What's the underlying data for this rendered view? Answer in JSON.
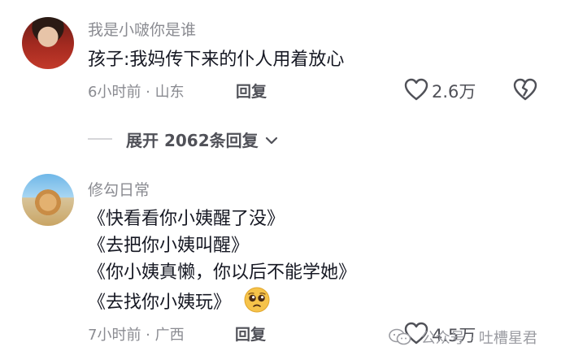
{
  "comments": [
    {
      "username": "我是小啵你是谁",
      "text_lines": [
        "孩子:我妈传下来的仆人用着放心"
      ],
      "meta": "6小时前 · 山东",
      "reply_label": "回复",
      "like_count": "2.6万"
    },
    {
      "username": "修勾日常",
      "text_lines": [
        "《快看看你小姨醒了没》",
        "《去把你小姨叫醒》",
        "《你小姨真懒，你以后不能学她》",
        "《去找你小姨玩》"
      ],
      "meta": "7小时前 · 广西",
      "reply_label": "回复",
      "like_count": "4.5万"
    }
  ],
  "expand_replies": "展开 2062条回复",
  "watermark": "公众号 · 吐槽星君",
  "icons": {
    "like": "heart-outline-icon",
    "dislike": "broken-heart-icon",
    "expand": "chevron-down-icon",
    "emoji": "pleading-face-emoji",
    "watermark": "wechat-icon"
  }
}
